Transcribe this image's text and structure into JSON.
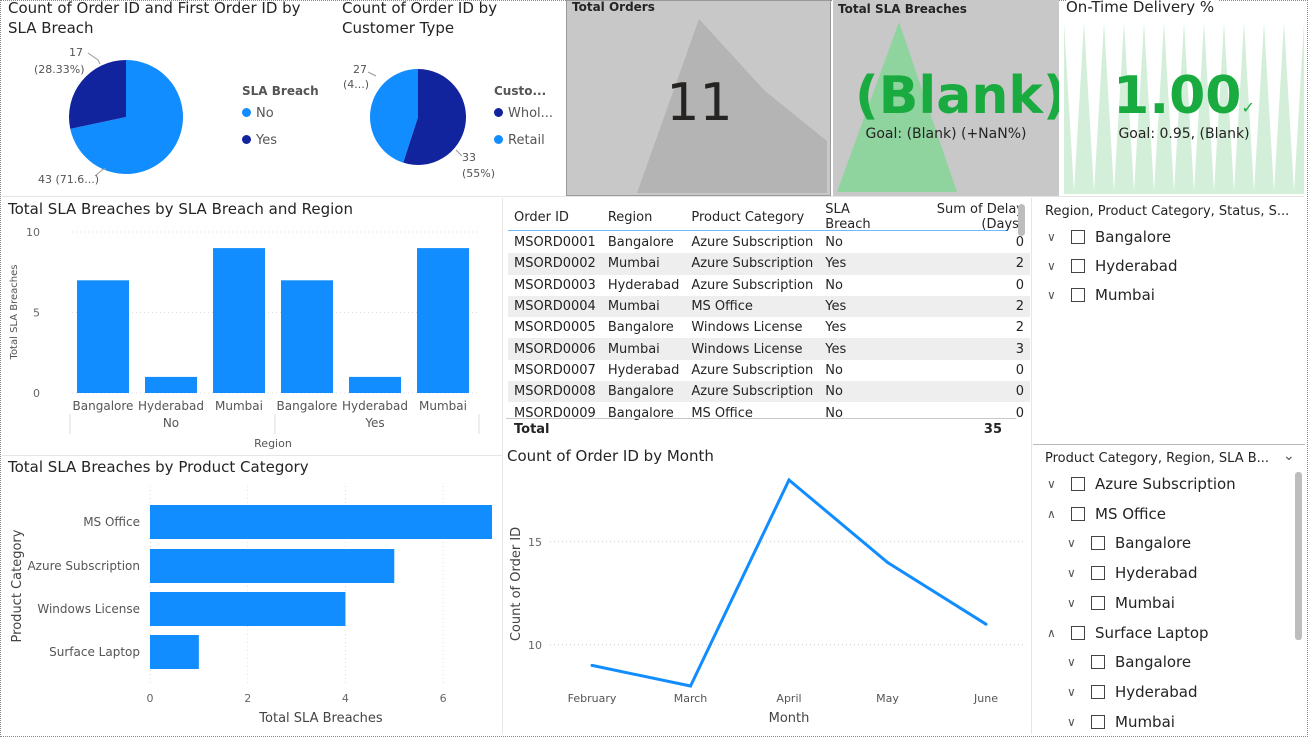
{
  "colors": {
    "light": "#118DFF",
    "dark": "#12239E",
    "green": "#1AAB40",
    "card_bg": "#c8c8c8",
    "kpi_bg": "#c8c8c8"
  },
  "pie1": {
    "title": "Count of Order ID and First Order ID by SLA Breach",
    "legend_title": "SLA Breach",
    "legend": [
      {
        "label": "No",
        "color": "#118DFF"
      },
      {
        "label": "Yes",
        "color": "#12239E"
      }
    ],
    "labels": {
      "yes_count": "17",
      "yes_pct": "(28.33%)",
      "no": "43 (71.6...)"
    }
  },
  "pie2": {
    "title": "Count of Order ID by Customer Type",
    "legend_title": "Custo...",
    "legend": [
      {
        "label": "Whol...",
        "color": "#12239E"
      },
      {
        "label": "Retail",
        "color": "#118DFF"
      }
    ],
    "labels": {
      "retail_count": "27",
      "retail_pct": "(4...)",
      "whol_count": "33",
      "whol_pct": "(55%)"
    }
  },
  "card_total_orders": {
    "title": "Total Orders",
    "value": "11"
  },
  "kpi_sla": {
    "title": "Total SLA Breaches",
    "value": "(Blank)",
    "goal": "Goal: (Blank) (+NaN%)",
    "check": "✓"
  },
  "kpi_ontime": {
    "title": "On-Time Delivery %",
    "value": "1.00",
    "goal": "Goal: 0.95, (Blank)",
    "check": "✓"
  },
  "chart_region": {
    "title": "Total SLA Breaches by SLA Breach and Region",
    "ylabel": "Total SLA Breaches",
    "xlabel": "Region",
    "yticks": [
      "10",
      "5",
      "0"
    ],
    "groups": [
      "No",
      "Yes"
    ]
  },
  "chart_product": {
    "title": "Total SLA Breaches by Product Category",
    "ylabel": "Product Category",
    "xlabel": "Total SLA Breaches",
    "xticks": [
      "0",
      "2",
      "4",
      "6"
    ]
  },
  "chart_month": {
    "title": "Count of Order ID by Month",
    "ylabel": "Count of Order ID",
    "xlabel": "Month",
    "yticks": [
      "15",
      "10"
    ]
  },
  "chart_data": [
    {
      "type": "bar",
      "title": "Total SLA Breaches by SLA Breach and Region",
      "categories": [
        "Bangalore",
        "Hyderabad",
        "Mumbai",
        "Bangalore",
        "Hyderabad",
        "Mumbai"
      ],
      "groups": [
        "No",
        "No",
        "No",
        "Yes",
        "Yes",
        "Yes"
      ],
      "values": [
        7,
        1,
        9,
        7,
        1,
        9
      ],
      "xlabel": "Region",
      "ylabel": "Total SLA Breaches",
      "ylim": [
        0,
        10
      ]
    },
    {
      "type": "bar",
      "orientation": "horizontal",
      "title": "Total SLA Breaches by Product Category",
      "categories": [
        "MS Office",
        "Azure Subscription",
        "Windows License",
        "Surface Laptop"
      ],
      "values": [
        7,
        5,
        4,
        1
      ],
      "xlabel": "Total SLA Breaches",
      "ylabel": "Product Category",
      "xlim": [
        0,
        7
      ]
    },
    {
      "type": "line",
      "title": "Count of Order ID by Month",
      "x": [
        "February",
        "March",
        "April",
        "May",
        "June"
      ],
      "values": [
        9,
        8,
        18,
        14,
        11
      ],
      "xlabel": "Month",
      "ylabel": "Count of Order ID",
      "ylim": [
        8,
        18
      ]
    },
    {
      "type": "pie",
      "title": "Count of Order ID and First Order ID by SLA Breach",
      "categories": [
        "Yes",
        "No"
      ],
      "values": [
        17,
        43
      ]
    },
    {
      "type": "pie",
      "title": "Count of Order ID by Customer Type",
      "categories": [
        "Retail",
        "Whol..."
      ],
      "values": [
        27,
        33
      ]
    }
  ],
  "table": {
    "headers": [
      "Order ID",
      "Region",
      "Product Category",
      "SLA Breach",
      "Sum of Delay (Days)"
    ],
    "rows": [
      [
        "MSORD0001",
        "Bangalore",
        "Azure Subscription",
        "No",
        "0"
      ],
      [
        "MSORD0002",
        "Mumbai",
        "Azure Subscription",
        "Yes",
        "2"
      ],
      [
        "MSORD0003",
        "Hyderabad",
        "Azure Subscription",
        "No",
        "0"
      ],
      [
        "MSORD0004",
        "Mumbai",
        "MS Office",
        "Yes",
        "2"
      ],
      [
        "MSORD0005",
        "Bangalore",
        "Windows License",
        "Yes",
        "2"
      ],
      [
        "MSORD0006",
        "Mumbai",
        "Windows License",
        "Yes",
        "3"
      ],
      [
        "MSORD0007",
        "Hyderabad",
        "Azure Subscription",
        "No",
        "0"
      ],
      [
        "MSORD0008",
        "Bangalore",
        "Azure Subscription",
        "No",
        "0"
      ],
      [
        "MSORD0009",
        "Bangalore",
        "MS Office",
        "No",
        "0"
      ]
    ],
    "total_label": "Total",
    "total_value": "35"
  },
  "slicer1": {
    "header": "Region, Product Category, Status, S...",
    "items": [
      "Bangalore",
      "Hyderabad",
      "Mumbai"
    ]
  },
  "slicer2": {
    "header": "Product Category, Region, SLA B...",
    "items": [
      {
        "label": "Azure Subscription",
        "level": 0,
        "chev": "∨"
      },
      {
        "label": "MS Office",
        "level": 0,
        "chev": "∧"
      },
      {
        "label": "Bangalore",
        "level": 1,
        "chev": "∨"
      },
      {
        "label": "Hyderabad",
        "level": 1,
        "chev": "∨"
      },
      {
        "label": "Mumbai",
        "level": 1,
        "chev": "∨"
      },
      {
        "label": "Surface Laptop",
        "level": 0,
        "chev": "∧"
      },
      {
        "label": "Bangalore",
        "level": 1,
        "chev": "∨"
      },
      {
        "label": "Hyderabad",
        "level": 1,
        "chev": "∨"
      },
      {
        "label": "Mumbai",
        "level": 1,
        "chev": "∨"
      }
    ]
  }
}
